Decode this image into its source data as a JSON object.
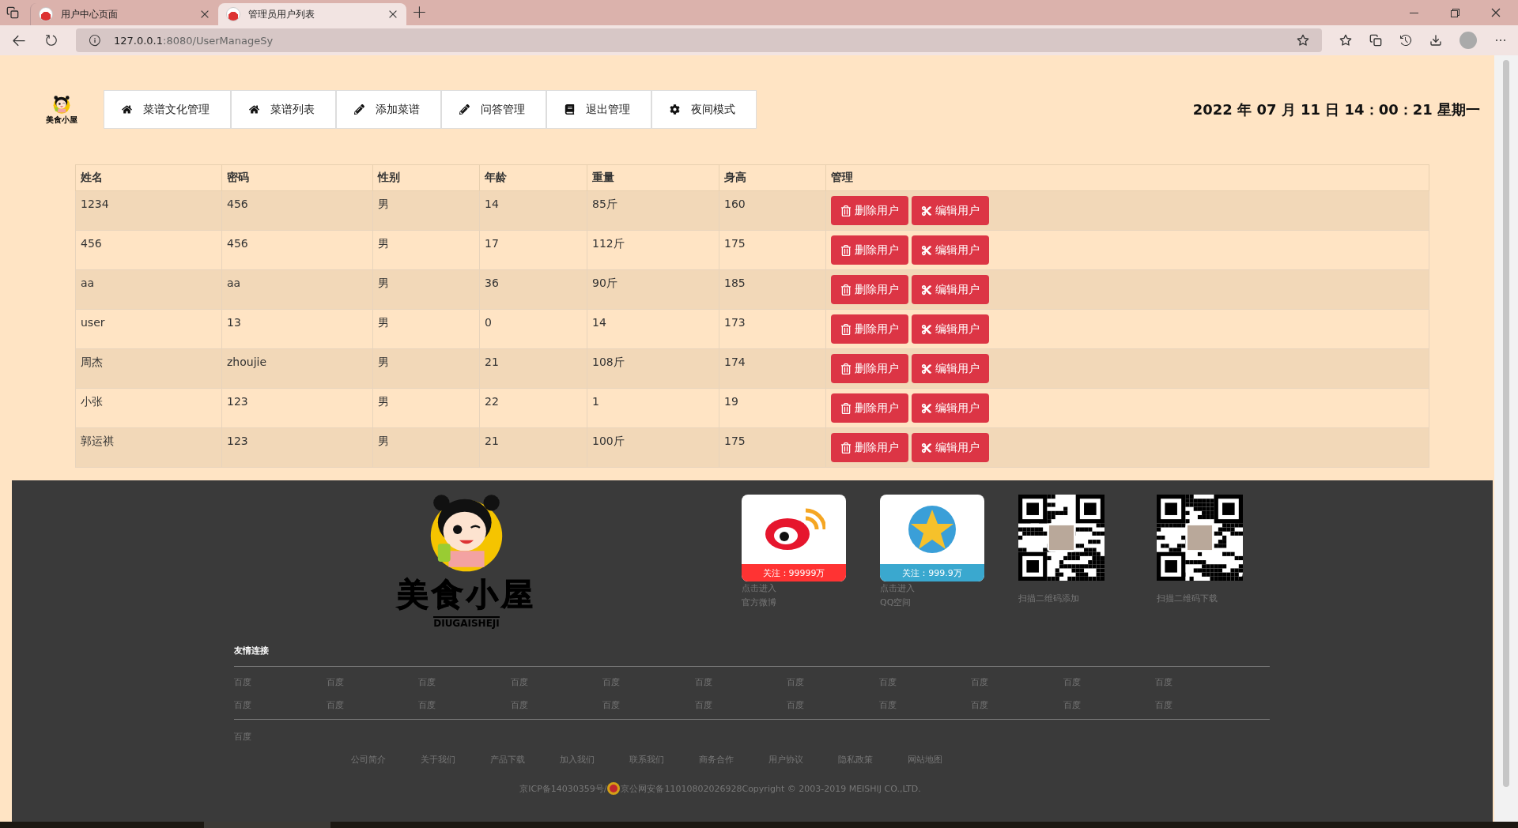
{
  "browser": {
    "tabs": [
      {
        "title": "用户中心页面",
        "selected": false
      },
      {
        "title": "管理员用户列表",
        "selected": true
      }
    ],
    "url_host": "127.0.0.1",
    "url_rest": ":8080/UserManageSy"
  },
  "header": {
    "logo_text": "美食小屋",
    "nav": [
      {
        "label": "菜谱文化管理"
      },
      {
        "label": "菜谱列表"
      },
      {
        "label": "添加菜谱"
      },
      {
        "label": "问答管理"
      },
      {
        "label": "退出管理"
      },
      {
        "label": "夜间模式"
      }
    ],
    "datetime": "2022 年 07 月 11 日 14：00：21 星期一"
  },
  "table": {
    "columns": [
      "姓名",
      "密码",
      "性别",
      "年龄",
      "重量",
      "身高",
      "管理"
    ],
    "rows": [
      {
        "cells": [
          "1234",
          "456",
          "男",
          "14",
          "85斤",
          "160"
        ],
        "actions": [
          "删除用户",
          "编辑用户"
        ]
      },
      {
        "cells": [
          "456",
          "456",
          "男",
          "17",
          "112斤",
          "175"
        ],
        "actions": [
          "删除用户",
          "编辑用户"
        ]
      },
      {
        "cells": [
          "aa",
          "aa",
          "男",
          "36",
          "90斤",
          "185"
        ],
        "actions": [
          "删除用户",
          "编辑用户"
        ]
      },
      {
        "cells": [
          "user",
          "13",
          "男",
          "0",
          "14",
          "173"
        ],
        "actions": [
          "删除用户",
          "编辑用户"
        ]
      },
      {
        "cells": [
          "周杰",
          "zhoujie",
          "男",
          "21",
          "108斤",
          "174"
        ],
        "actions": [
          "删除用户",
          "编辑用户"
        ]
      },
      {
        "cells": [
          "小张",
          "123",
          "男",
          "22",
          "1",
          "19"
        ],
        "actions": [
          "删除用户",
          "编辑用户"
        ]
      },
      {
        "cells": [
          "郭运祺",
          "123",
          "男",
          "21",
          "100斤",
          "175"
        ],
        "actions": [
          "删除用户",
          "编辑用户"
        ]
      }
    ]
  },
  "footer": {
    "brand": "美食小屋",
    "brand_sub": "DIUGAISHEJI",
    "cards": [
      {
        "kind": "weibo",
        "badge": "关注：99999万",
        "color": "#ff3333",
        "line1": "点击进入",
        "line2": "官方微博"
      },
      {
        "kind": "qq",
        "badge": "关注：999.9万",
        "color": "#3aa8cf",
        "line1": "点击进入",
        "line2": "QQ空间"
      },
      {
        "kind": "qr",
        "caption": "扫描二维码添加"
      },
      {
        "kind": "qr",
        "caption": "扫描二维码下载"
      }
    ],
    "links_title": "友情连接",
    "links": [
      "百度",
      "百度",
      "百度",
      "百度",
      "百度",
      "百度",
      "百度",
      "百度",
      "百度",
      "百度",
      "百度",
      "百度",
      "百度",
      "百度",
      "百度",
      "百度",
      "百度",
      "百度",
      "百度",
      "百度",
      "百度",
      "百度"
    ],
    "extra_link": "百度",
    "bottom_links": [
      "公司简介",
      "关于我们",
      "产品下载",
      "加入我们",
      "联系我们",
      "商务合作",
      "用户协议",
      "隐私政策",
      "网站地图"
    ],
    "icp": "京ICP备14030359号/",
    "police": "京公网安备11010802026928Copyright © 2003-2019 MEISHIJ CO.,LTD."
  }
}
